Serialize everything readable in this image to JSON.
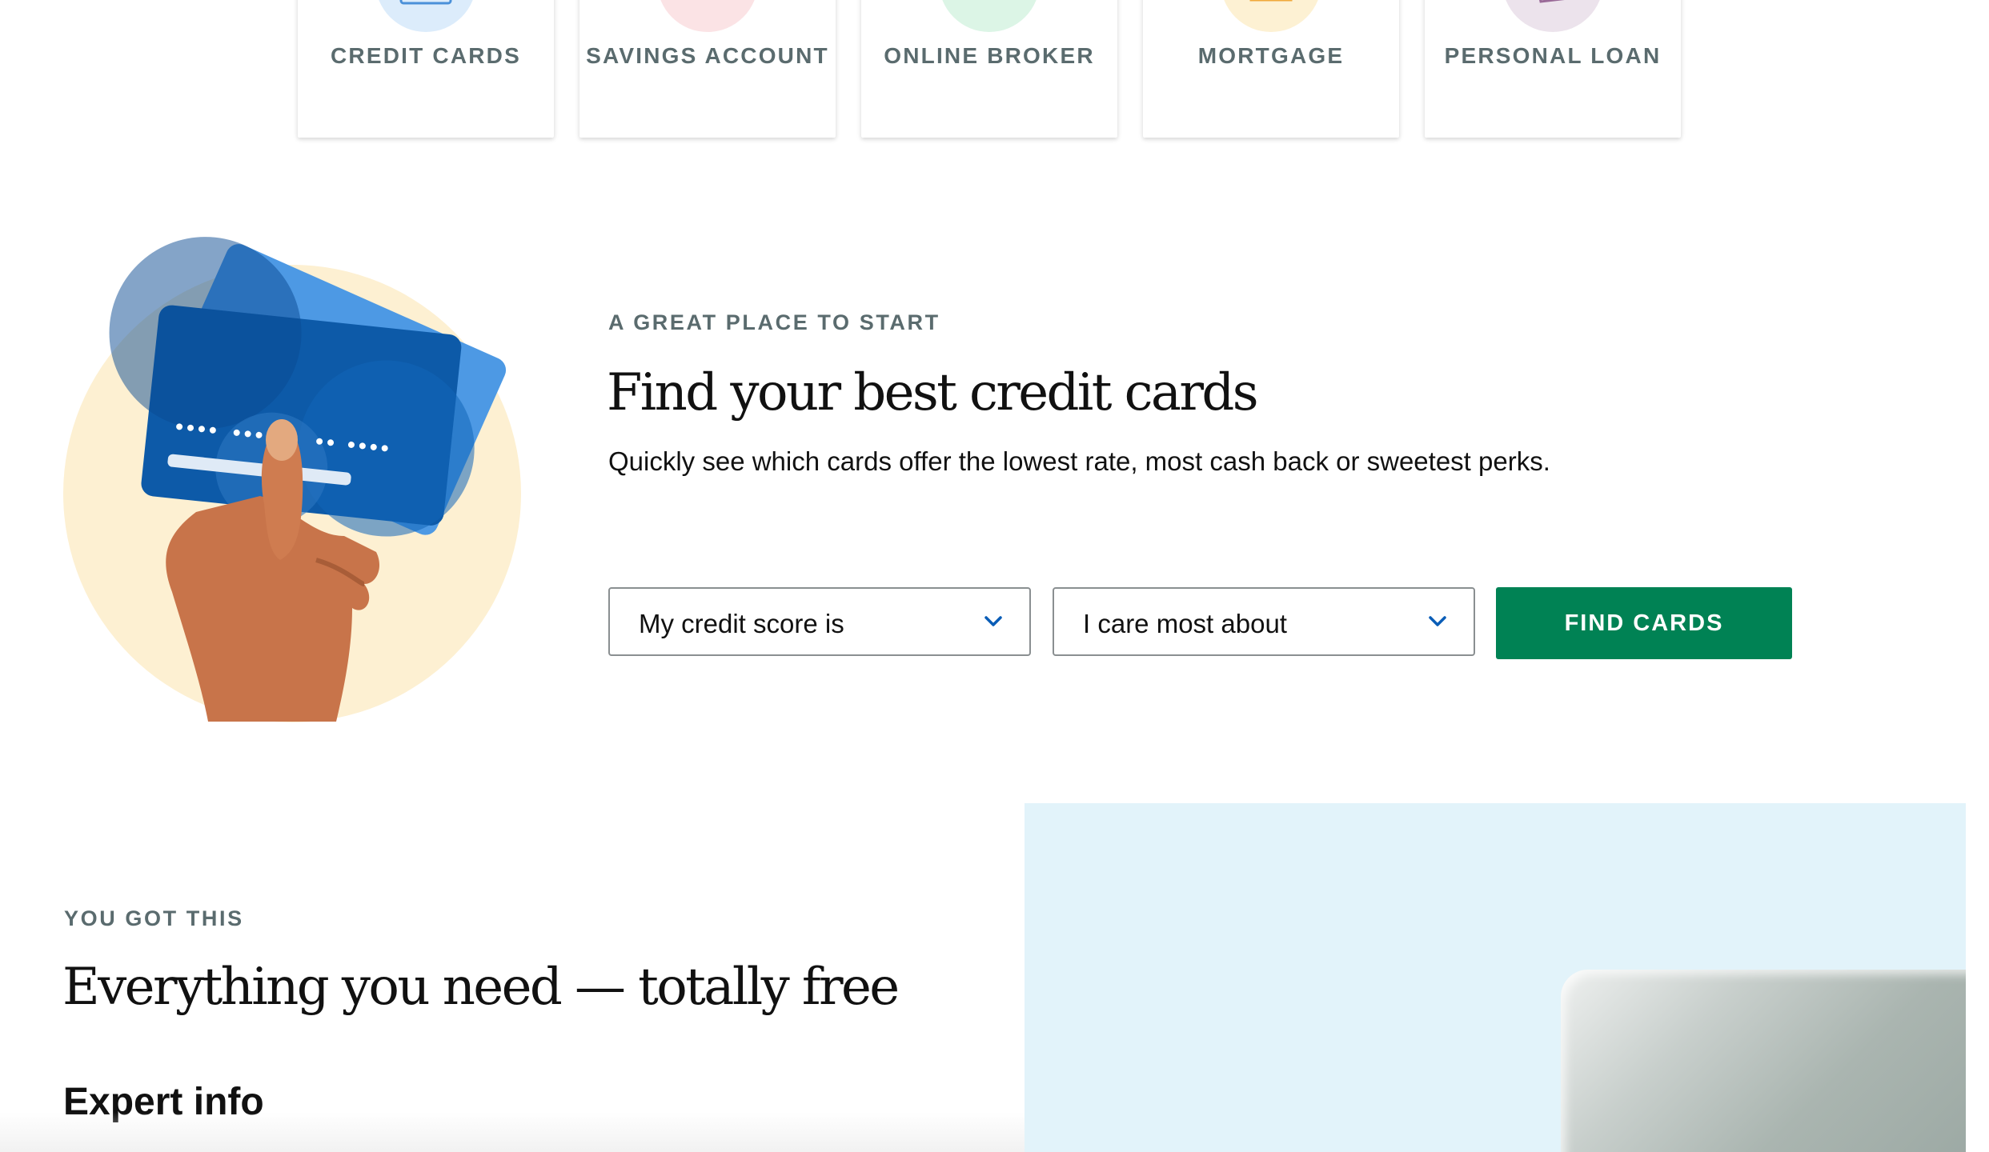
{
  "categories": [
    {
      "label": "CREDIT CARDS",
      "icon": "credit-card-icon",
      "color": "#dcecfb"
    },
    {
      "label": "SAVINGS ACCOUNT",
      "icon": "bank-icon",
      "color": "#fbe3e5"
    },
    {
      "label": "ONLINE BROKER",
      "icon": "bar-chart-icon",
      "color": "#dcf5e6"
    },
    {
      "label": "MORTGAGE",
      "icon": "house-icon",
      "color": "#fdf1d3"
    },
    {
      "label": "PERSONAL LOAN",
      "icon": "cash-icon",
      "color": "#ece3ec"
    }
  ],
  "finder": {
    "eyebrow": "A GREAT PLACE TO START",
    "title": "Find your best credit cards",
    "subtitle": "Quickly see which cards offer the lowest rate, most cash back or sweetest perks.",
    "credit_score_select": "My credit score is",
    "priority_select": "I care most about",
    "cta_label": "FIND CARDS",
    "cta_color": "#008254"
  },
  "promo": {
    "eyebrow": "YOU GOT THIS",
    "title": "Everything you need — totally free",
    "subheading": "Expert info"
  }
}
